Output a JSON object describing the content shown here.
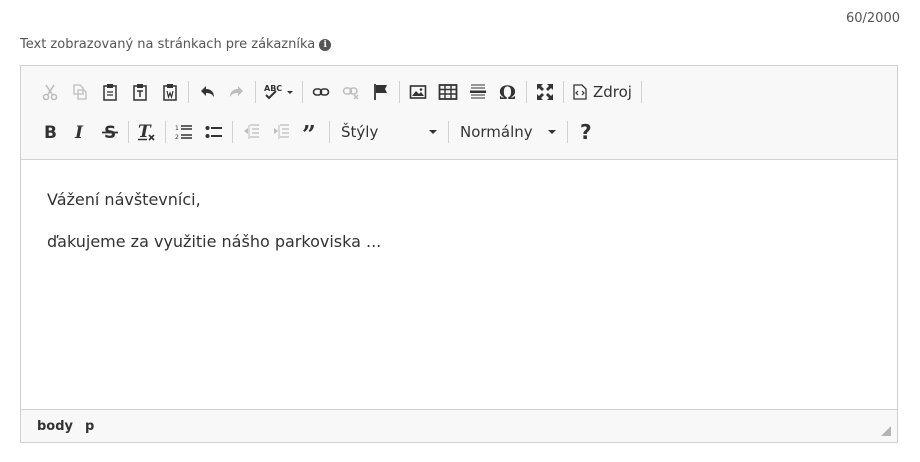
{
  "counter": "60/2000",
  "field": {
    "label": "Text zobrazovaný na stránkach pre zákazníka"
  },
  "toolbar": {
    "source_label": "Zdroj",
    "styles_value": "Štýly",
    "format_value": "Normálny"
  },
  "content": {
    "paragraphs": [
      "Vážení návštevníci,",
      "ďakujeme za využitie nášho parkoviska ..."
    ]
  },
  "statusbar": {
    "path": [
      "body",
      "p"
    ]
  },
  "colors": {
    "toolbar_bg": "#f8f8f8",
    "border": "#d1d1d1",
    "icon": "#333333",
    "icon_disabled": "#bdbdbd"
  }
}
